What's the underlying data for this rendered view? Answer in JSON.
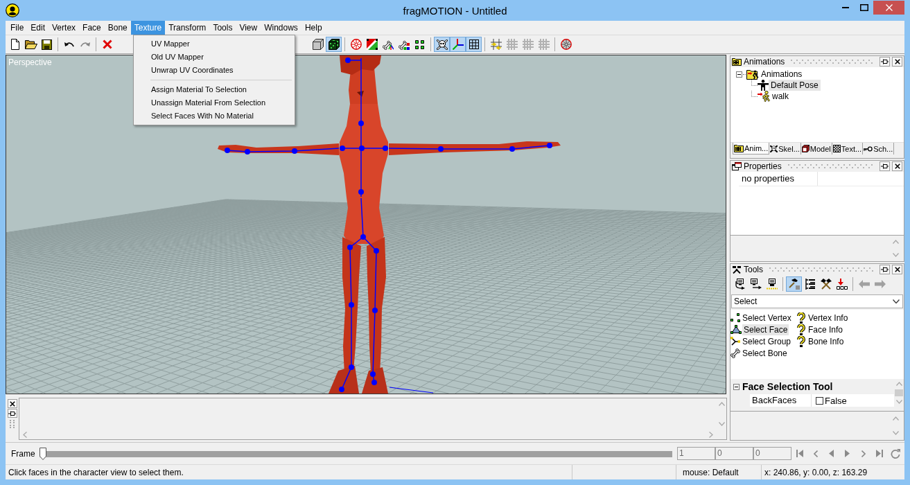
{
  "window": {
    "title": "fragMOTION - Untitled"
  },
  "menu_bar": [
    {
      "label": "File",
      "selected": false
    },
    {
      "label": "Edit",
      "selected": false
    },
    {
      "label": "Vertex",
      "selected": false
    },
    {
      "label": "Face",
      "selected": false
    },
    {
      "label": "Bone",
      "selected": false
    },
    {
      "label": "Texture",
      "selected": true
    },
    {
      "label": "Transform",
      "selected": false
    },
    {
      "label": "Tools",
      "selected": false
    },
    {
      "label": "View",
      "selected": false
    },
    {
      "label": "Windows",
      "selected": false
    },
    {
      "label": "Help",
      "selected": false
    }
  ],
  "toolbar": {
    "left_groups": [
      [
        {
          "pressed": false,
          "disabled": false
        },
        {
          "pressed": false,
          "disabled": false
        },
        {
          "pressed": false,
          "disabled": false
        }
      ],
      [
        {
          "pressed": false,
          "disabled": false
        },
        {
          "pressed": false,
          "disabled": true
        }
      ],
      [
        {
          "pressed": false,
          "disabled": false
        }
      ]
    ],
    "right_groups": [
      [
        {
          "pressed": false,
          "disabled": false
        },
        {
          "pressed": true,
          "disabled": false
        }
      ],
      [
        {
          "pressed": false,
          "disabled": false
        },
        {
          "pressed": false,
          "disabled": false
        },
        {
          "pressed": false,
          "disabled": false
        },
        {
          "pressed": false,
          "disabled": false
        },
        {
          "pressed": false,
          "disabled": false
        }
      ],
      [
        {
          "pressed": true,
          "disabled": false
        },
        {
          "pressed": true,
          "disabled": false
        },
        {
          "pressed": true,
          "disabled": false
        }
      ],
      [
        {
          "pressed": false,
          "disabled": false
        },
        {
          "pressed": false,
          "disabled": true
        },
        {
          "pressed": false,
          "disabled": true
        },
        {
          "pressed": false,
          "disabled": true
        }
      ],
      [
        {
          "pressed": false,
          "disabled": false
        }
      ]
    ]
  },
  "open_menu": {
    "groups": [
      [
        "UV Mapper",
        "Old UV Mapper",
        "Unwrap UV Coordinates"
      ],
      [
        "Assign Material To Selection",
        "Unassign Material From Selection",
        "Select Faces With No Material"
      ]
    ]
  },
  "viewport": {
    "label": "Perspective"
  },
  "animations_panel": {
    "title": "Animations",
    "tree": [
      {
        "label": "Animations",
        "kind": "group",
        "expanded": true,
        "selected": false,
        "children": [
          {
            "label": "Default Pose",
            "kind": "pose",
            "selected": true
          },
          {
            "label": "walk",
            "kind": "animation",
            "selected": false
          }
        ]
      }
    ],
    "tabs": [
      {
        "label": "Anim...",
        "selected": true
      },
      {
        "label": "Skel...",
        "selected": false
      },
      {
        "label": "Model",
        "selected": false
      },
      {
        "label": "Text...",
        "selected": false
      },
      {
        "label": "Sch...",
        "selected": false
      }
    ]
  },
  "properties_panel": {
    "title": "Properties",
    "message": "no properties"
  },
  "tools_panel": {
    "title": "Tools",
    "toolbar": [
      [
        {
          "pressed": false,
          "disabled": false
        },
        {
          "pressed": false,
          "disabled": false
        },
        {
          "pressed": false,
          "disabled": false
        }
      ],
      [
        {
          "pressed": true,
          "disabled": false
        },
        {
          "pressed": false,
          "disabled": false
        },
        {
          "pressed": false,
          "disabled": false
        },
        {
          "pressed": false,
          "disabled": false
        }
      ],
      [
        {
          "pressed": false,
          "disabled": true
        },
        {
          "pressed": false,
          "disabled": true
        }
      ]
    ],
    "mode": "Select",
    "tools": [
      {
        "label": "Select Vertex",
        "selected": false
      },
      {
        "label": "Select Face",
        "selected": true
      },
      {
        "label": "Select Group",
        "selected": false
      },
      {
        "label": "Select Bone",
        "selected": false
      },
      {
        "label": "Vertex Info",
        "selected": false
      },
      {
        "label": "Face Info",
        "selected": false
      },
      {
        "label": "Bone Info",
        "selected": false
      }
    ],
    "property_grid": {
      "category": "Face Selection Tool",
      "expanded": true,
      "rows": [
        {
          "name": "BackFaces",
          "checked": false,
          "value": "False"
        }
      ]
    }
  },
  "frame_bar": {
    "label": "Frame",
    "slider": {
      "level": 0
    },
    "fields": [
      "1",
      "0",
      "0"
    ]
  },
  "status_bar": {
    "message": "Click faces in the character view to select them.",
    "mouse": "mouse: Default",
    "coordinates": "x: 240.86, y: 0.00, z: 163.29"
  }
}
